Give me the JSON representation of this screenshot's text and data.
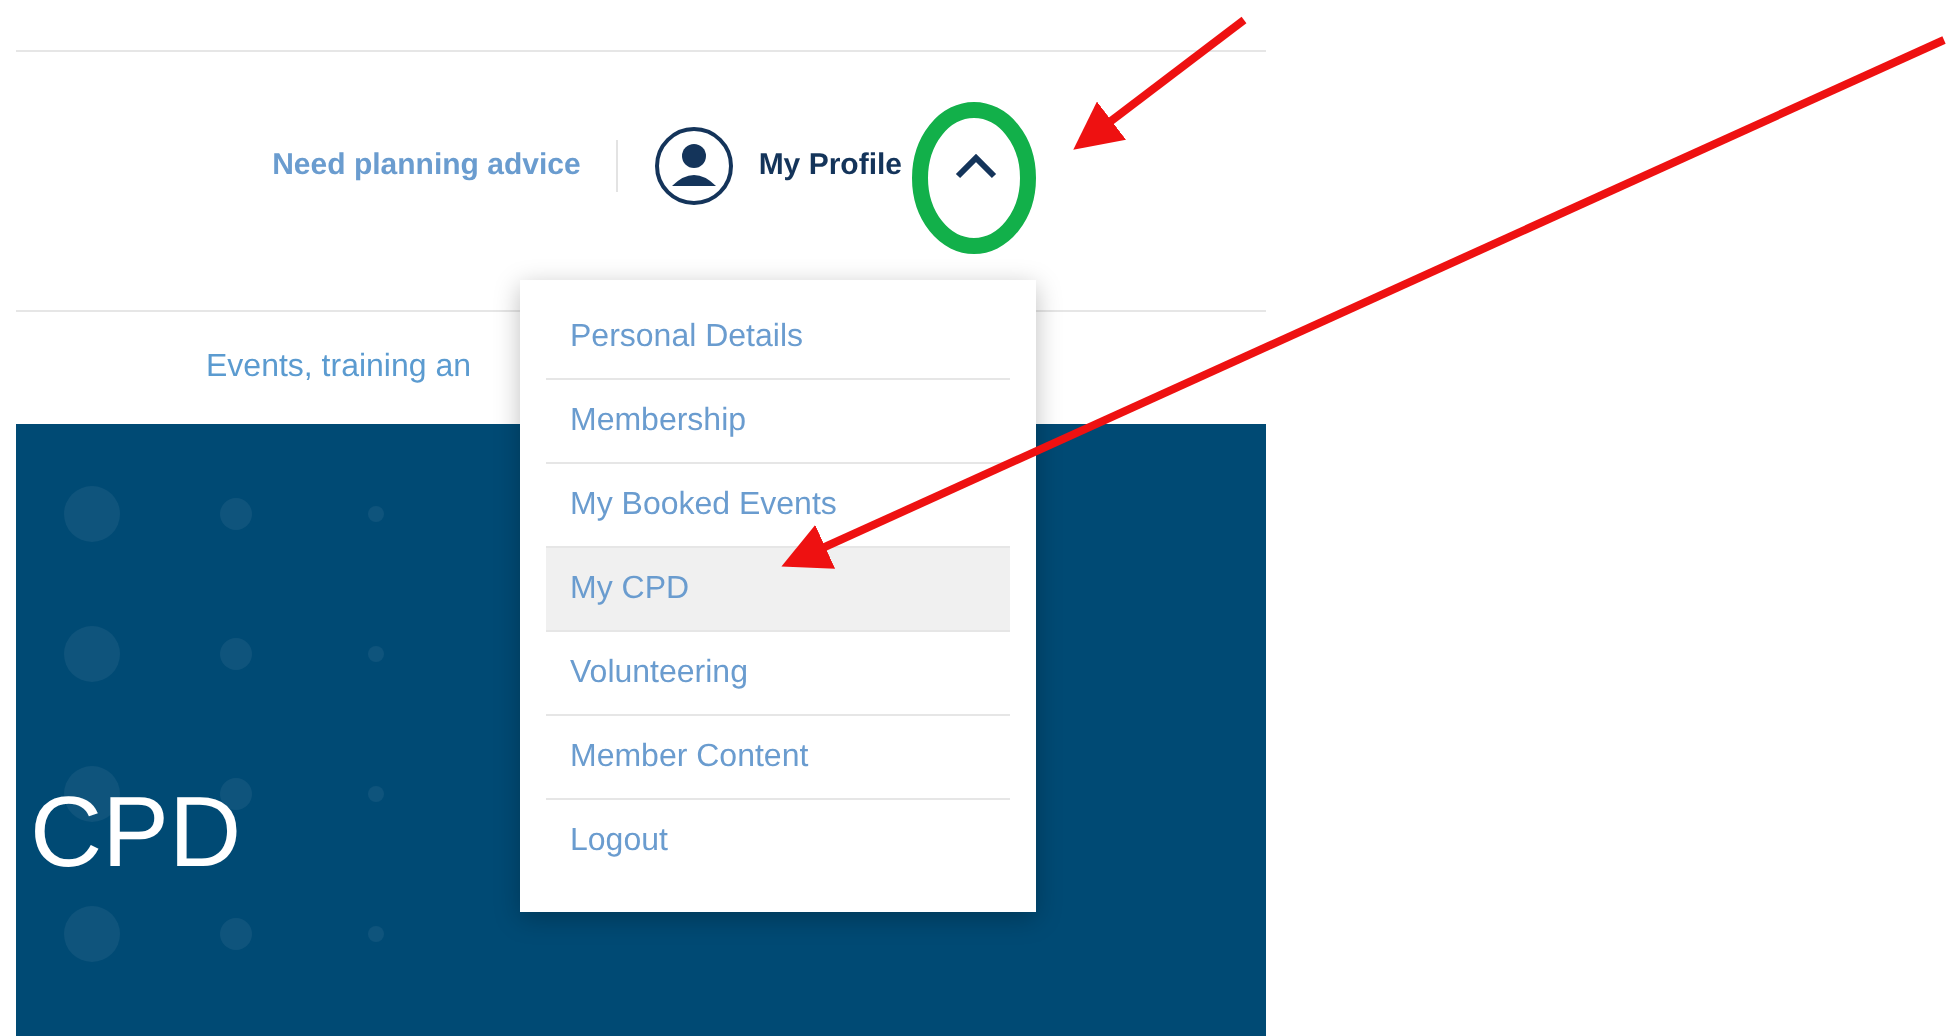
{
  "header": {
    "advice_link": "Need planning advice",
    "profile": {
      "label": "My Profile",
      "expanded": true
    }
  },
  "nav": {
    "link": "Events, training an"
  },
  "banner": {
    "title": "CPD"
  },
  "profile_menu": [
    {
      "label": "Personal Details",
      "selected": false
    },
    {
      "label": "Membership",
      "selected": false
    },
    {
      "label": "My Booked Events",
      "selected": false
    },
    {
      "label": "My CPD",
      "selected": true
    },
    {
      "label": "Volunteering",
      "selected": false
    },
    {
      "label": "Member Content",
      "selected": false
    },
    {
      "label": "Logout",
      "selected": false
    }
  ]
}
